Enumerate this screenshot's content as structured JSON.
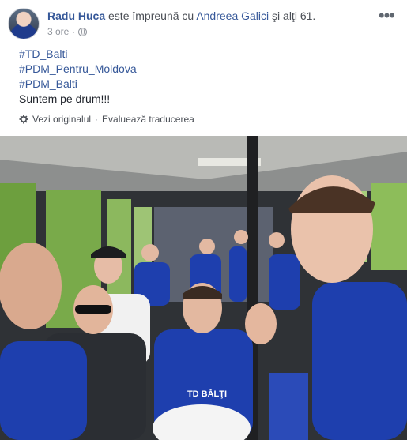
{
  "post": {
    "author": "Radu Huca",
    "with_text": "este împreună cu",
    "tagged": "Andreea Galici",
    "others": "şi alţi 61.",
    "time": "3 ore",
    "more_icon": "more-horizontal-icon",
    "privacy_icon": "globe-icon"
  },
  "content": {
    "lines": [
      "#TD_Balti",
      "#PDM_Pentru_Moldova",
      "#PDM_Balti",
      "Suntem pe drum!!!"
    ]
  },
  "translation": {
    "see_original": "Vezi originalul",
    "separator": "·",
    "rate": "Evaluează traducerea",
    "icon": "gear-icon"
  },
  "photo": {
    "shirt_text": "TD BĂLŢI",
    "colors": {
      "shirt": "#1e3fae",
      "window": "#6d9f3e",
      "bus_interior": "#3a3d42"
    }
  }
}
